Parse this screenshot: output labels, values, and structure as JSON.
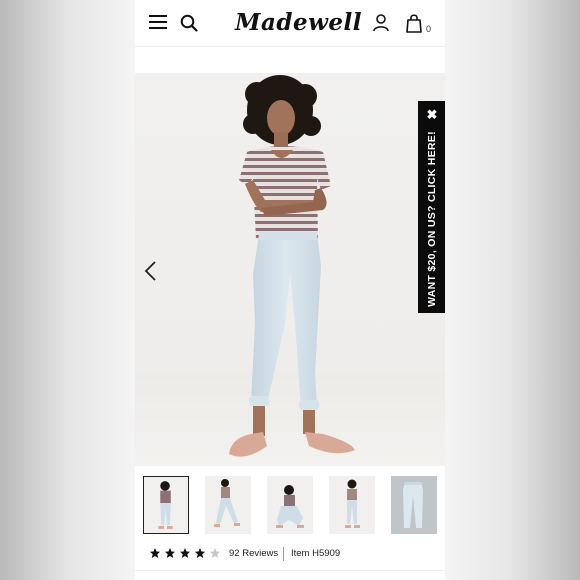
{
  "brand": {
    "logo": "Madewell"
  },
  "header": {
    "bag_count": "0"
  },
  "promo": {
    "text": "WANT $20, ON US? CLICK HERE!",
    "close_glyph": "✖"
  },
  "product": {
    "rating": 4,
    "rating_max": 5,
    "reviews_label": "92 Reviews",
    "item_label": "Item H5909"
  },
  "thumbnails": [
    {
      "name": "front-standing",
      "active": true
    },
    {
      "name": "side-step"
    },
    {
      "name": "crouching"
    },
    {
      "name": "hands-in-pockets"
    },
    {
      "name": "flat-lay-jeans"
    }
  ],
  "colors": {
    "shirt_stripe_a": "#8b7076",
    "shirt_stripe_b": "#e9e2df",
    "jeans": "#cfdde6",
    "skin": "#a0735a",
    "hair": "#1f1712",
    "sandals": "#d9a998",
    "promo_bg": "#0b0b0b"
  }
}
